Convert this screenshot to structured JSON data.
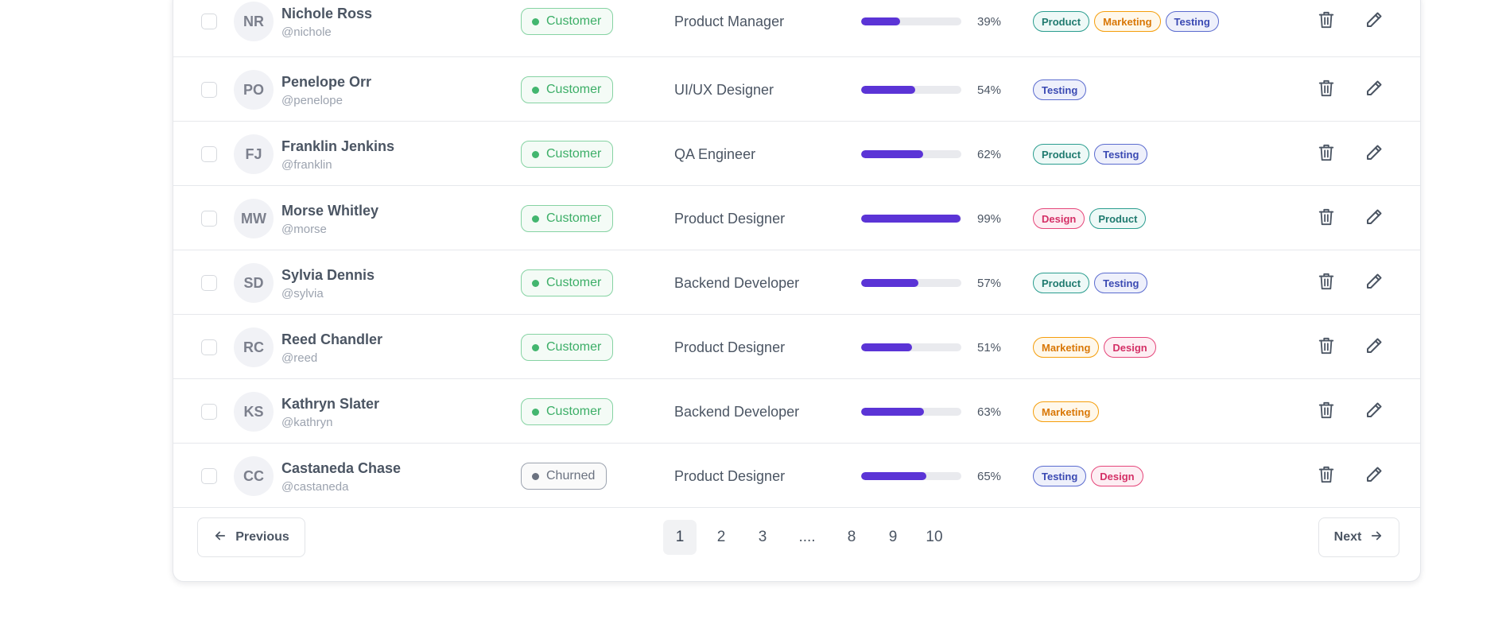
{
  "rows": [
    {
      "initials": "NR",
      "name": "Nichole Ross",
      "handle": "@nichole",
      "status": "Customer",
      "role": "Product Manager",
      "progress": 39,
      "progress_label": "39%",
      "tags": [
        "Product",
        "Marketing",
        "Testing"
      ]
    },
    {
      "initials": "PO",
      "name": "Penelope Orr",
      "handle": "@penelope",
      "status": "Customer",
      "role": "UI/UX Designer",
      "progress": 54,
      "progress_label": "54%",
      "tags": [
        "Testing"
      ]
    },
    {
      "initials": "FJ",
      "name": "Franklin Jenkins",
      "handle": "@franklin",
      "status": "Customer",
      "role": "QA Engineer",
      "progress": 62,
      "progress_label": "62%",
      "tags": [
        "Product",
        "Testing"
      ]
    },
    {
      "initials": "MW",
      "name": "Morse Whitley",
      "handle": "@morse",
      "status": "Customer",
      "role": "Product Designer",
      "progress": 99,
      "progress_label": "99%",
      "tags": [
        "Design",
        "Product"
      ]
    },
    {
      "initials": "SD",
      "name": "Sylvia Dennis",
      "handle": "@sylvia",
      "status": "Customer",
      "role": "Backend Developer",
      "progress": 57,
      "progress_label": "57%",
      "tags": [
        "Product",
        "Testing"
      ]
    },
    {
      "initials": "RC",
      "name": "Reed Chandler",
      "handle": "@reed",
      "status": "Customer",
      "role": "Product Designer",
      "progress": 51,
      "progress_label": "51%",
      "tags": [
        "Marketing",
        "Design"
      ]
    },
    {
      "initials": "KS",
      "name": "Kathryn Slater",
      "handle": "@kathryn",
      "status": "Customer",
      "role": "Backend Developer",
      "progress": 63,
      "progress_label": "63%",
      "tags": [
        "Marketing"
      ]
    },
    {
      "initials": "CC",
      "name": "Castaneda Chase",
      "handle": "@castaneda",
      "status": "Churned",
      "role": "Product Designer",
      "progress": 65,
      "progress_label": "65%",
      "tags": [
        "Testing",
        "Design"
      ]
    }
  ],
  "pagination": {
    "previous_label": "Previous",
    "next_label": "Next",
    "pages": [
      "1",
      "2",
      "3",
      "....",
      "8",
      "9",
      "10"
    ],
    "active_page": "1"
  },
  "icons": {
    "delete": "trash-icon",
    "edit": "pencil-icon",
    "previous": "arrow-left-icon",
    "next": "arrow-right-icon"
  },
  "colors": {
    "progress_fill": "#5b34d6",
    "customer": "#43b66f",
    "churned": "#6b7280",
    "tag_product": "#2a9d8f",
    "tag_marketing": "#f59e0b",
    "tag_testing": "#5a6bcf",
    "tag_design": "#e5467a"
  }
}
